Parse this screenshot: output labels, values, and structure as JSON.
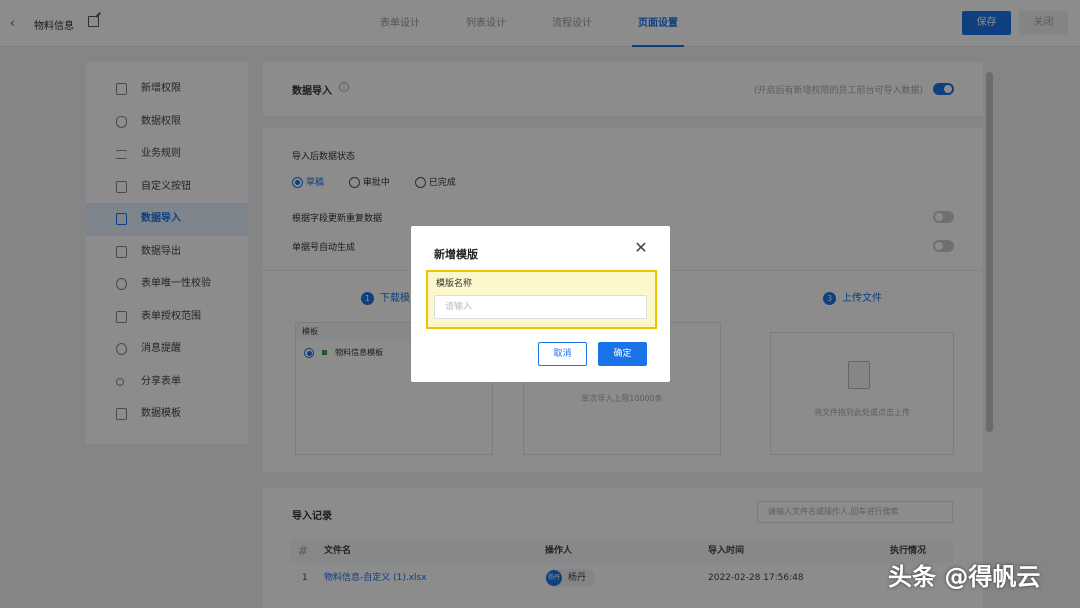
{
  "header": {
    "back_icon": "chevron-left-icon",
    "app_title": "物料信息",
    "tabs": [
      {
        "label": "表单设计"
      },
      {
        "label": "列表设计"
      },
      {
        "label": "流程设计"
      },
      {
        "label": "页面设置",
        "active": true
      }
    ],
    "save_label": "保存",
    "close_label": "关闭"
  },
  "sidebar": {
    "items": [
      {
        "label": "新增权限",
        "icon": "file-plus-icon"
      },
      {
        "label": "数据权限",
        "icon": "shield-icon"
      },
      {
        "label": "业务规则",
        "icon": "sliders-icon"
      },
      {
        "label": "自定义按钮",
        "icon": "button-icon"
      },
      {
        "label": "数据导入",
        "icon": "import-icon",
        "active": true
      },
      {
        "label": "数据导出",
        "icon": "export-icon"
      },
      {
        "label": "表单唯一性校验",
        "icon": "check-icon"
      },
      {
        "label": "表单授权范围",
        "icon": "lock-icon"
      },
      {
        "label": "消息提醒",
        "icon": "clock-icon"
      },
      {
        "label": "分享表单",
        "icon": "share-icon"
      },
      {
        "label": "数据模板",
        "icon": "template-icon"
      }
    ]
  },
  "import_section": {
    "title": "数据导入",
    "hint": "(开启后有新增权限的员工前台可导入数据)",
    "enabled": true
  },
  "settings": {
    "status_label": "导入后数据状态",
    "status_options": [
      {
        "label": "草稿",
        "checked": true
      },
      {
        "label": "审批中",
        "checked": false
      },
      {
        "label": "已完成",
        "checked": false
      }
    ],
    "update_dup_label": "根据字段更新重复数据",
    "auto_number_label": "单据号自动生成"
  },
  "steps": {
    "step1_num": "1",
    "step1_label": "下载模",
    "step3_num": "3",
    "step3_label": "上传文件",
    "template_header": "模板",
    "template_item": "物料信息模板",
    "limit_text": "单次导入上限10000条",
    "upload_hint": "将文件拖到此处或点击上传"
  },
  "records": {
    "title": "导入记录",
    "search_placeholder": "请输入文件名或操作人,回车进行搜索",
    "columns": [
      "#",
      "文件名",
      "操作人",
      "导入时间",
      "执行情况"
    ],
    "rows": [
      {
        "index": "1",
        "file": "物料信息-自定义 (1).xlsx",
        "avatar": "杨丹",
        "operator": "杨丹",
        "time": "2022-02-28 17:56:48"
      }
    ]
  },
  "dialog": {
    "title": "新增模版",
    "field_label": "模版名称",
    "field_placeholder": "请输入",
    "cancel_label": "取消",
    "ok_label": "确定"
  },
  "watermark": "头条 @得帆云",
  "colors": {
    "accent": "#1b73e8",
    "highlight_border": "#f2c400",
    "highlight_fill": "#fdf7cc"
  }
}
